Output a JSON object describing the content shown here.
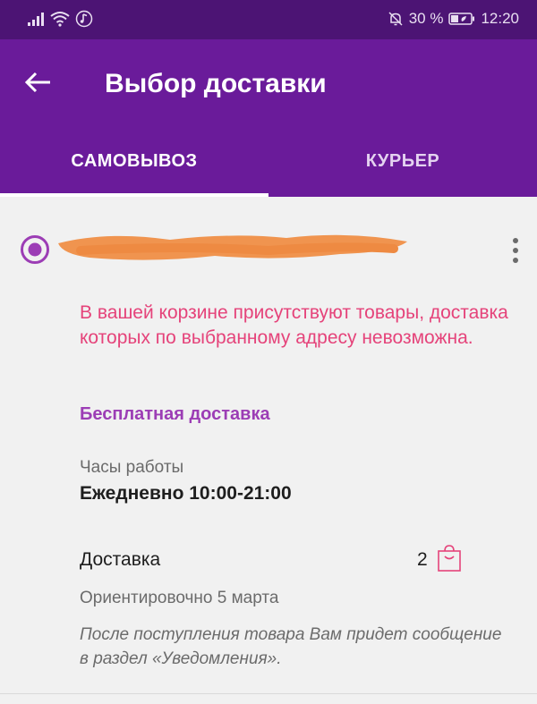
{
  "status_bar": {
    "battery": "30 %",
    "time": "12:20"
  },
  "header": {
    "title": "Выбор доставки"
  },
  "tabs": [
    {
      "label": "САМОВЫВОЗ",
      "active": true
    },
    {
      "label": "КУРЬЕР",
      "active": false
    }
  ],
  "pickup_point": {
    "warning": "В вашей корзине присутствуют товары, доставка которых по выбранному адресу невозможна.",
    "free_delivery": "Бесплатная доставка",
    "hours_label": "Часы работы",
    "hours_value": "Ежедневно 10:00-21:00",
    "delivery_label": "Доставка",
    "delivery_count": "2",
    "eta": "Ориентировочно 5 марта",
    "note": "После поступления товара Вам придет сообщение в раздел «Уведомления»."
  },
  "colors": {
    "status_bar": "#4c1474",
    "app_bar": "#6a1b9a",
    "accent": "#9c3db5",
    "warning": "#e5437a"
  }
}
